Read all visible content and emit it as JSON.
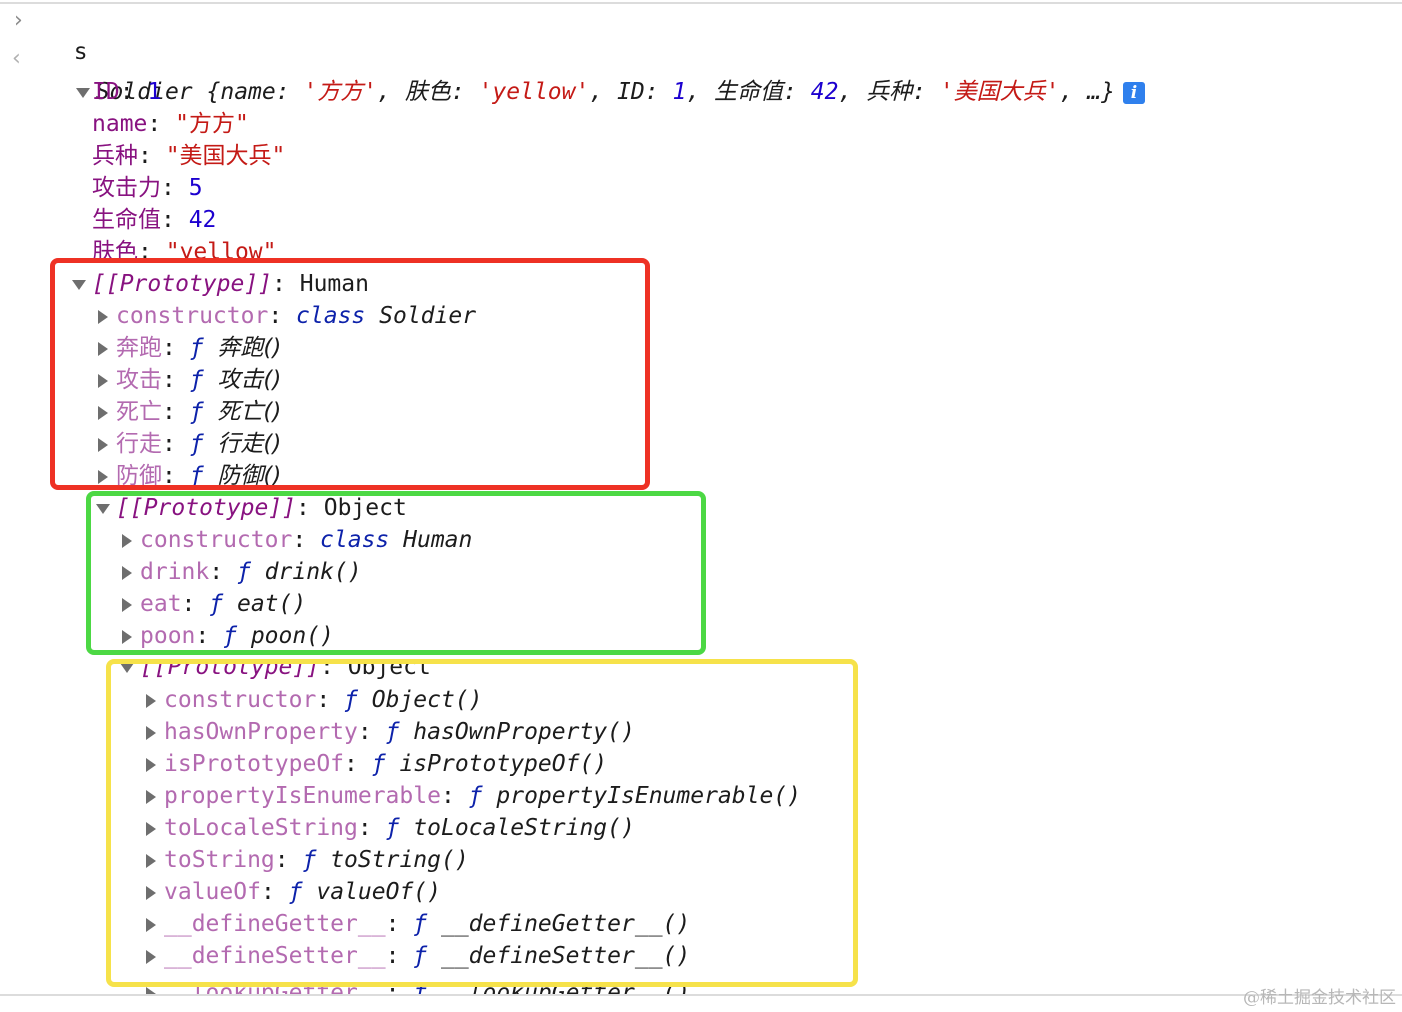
{
  "console": {
    "prompt_symbol": "›",
    "input": "s",
    "result_symbol": "‹",
    "summary": {
      "class_name": "Soldier",
      "open": "{",
      "close": "…}",
      "entries": [
        {
          "key": "name",
          "value": "'方方'",
          "type": "str"
        },
        {
          "key": "肤色",
          "value": "'yellow'",
          "type": "str"
        },
        {
          "key": "ID",
          "value": "1",
          "type": "num"
        },
        {
          "key": "生命值",
          "value": "42",
          "type": "num"
        },
        {
          "key": "兵种",
          "value": "'美国大兵'",
          "type": "str"
        }
      ],
      "info_icon": "i"
    },
    "own_properties": [
      {
        "key": "ID",
        "value": "1",
        "type": "num"
      },
      {
        "key": "name",
        "value": "\"方方\"",
        "type": "str"
      },
      {
        "key": "兵种",
        "value": "\"美国大兵\"",
        "type": "str"
      },
      {
        "key": "攻击力",
        "value": "5",
        "type": "num"
      },
      {
        "key": "生命值",
        "value": "42",
        "type": "num"
      },
      {
        "key": "肤色",
        "value": "\"yellow\"",
        "type": "str"
      }
    ],
    "proto_label": "[[Prototype]]",
    "prototype_human": {
      "value": "Human",
      "constructor": {
        "key": "constructor",
        "keyword": "class",
        "name": "Soldier"
      },
      "methods": [
        {
          "key": "奔跑",
          "sig": "奔跑()"
        },
        {
          "key": "攻击",
          "sig": "攻击()"
        },
        {
          "key": "死亡",
          "sig": "死亡()"
        },
        {
          "key": "行走",
          "sig": "行走()"
        },
        {
          "key": "防御",
          "sig": "防御()"
        }
      ]
    },
    "prototype_object_human": {
      "value": "Object",
      "constructor": {
        "key": "constructor",
        "keyword": "class",
        "name": "Human"
      },
      "methods": [
        {
          "key": "drink",
          "sig": "drink()"
        },
        {
          "key": "eat",
          "sig": "eat()"
        },
        {
          "key": "poon",
          "sig": "poon()"
        }
      ]
    },
    "prototype_object": {
      "value": "Object",
      "methods": [
        {
          "key": "constructor",
          "sig": "Object()"
        },
        {
          "key": "hasOwnProperty",
          "sig": "hasOwnProperty()"
        },
        {
          "key": "isPrototypeOf",
          "sig": "isPrototypeOf()"
        },
        {
          "key": "propertyIsEnumerable",
          "sig": "propertyIsEnumerable()"
        },
        {
          "key": "toLocaleString",
          "sig": "toLocaleString()"
        },
        {
          "key": "toString",
          "sig": "toString()"
        },
        {
          "key": "valueOf",
          "sig": "valueOf()"
        },
        {
          "key": "__defineGetter__",
          "sig": "__defineGetter__()"
        },
        {
          "key": "__defineSetter__",
          "sig": "__defineSetter__()"
        },
        {
          "key": "__lookupGetter__",
          "sig": "__lookupGetter__()"
        }
      ]
    },
    "func_symbol": "ƒ"
  },
  "highlight_colors": {
    "red": "#ee3124",
    "green": "#4cd844",
    "yellow": "#f6e24a"
  },
  "watermark": "@稀土掘金技术社区"
}
